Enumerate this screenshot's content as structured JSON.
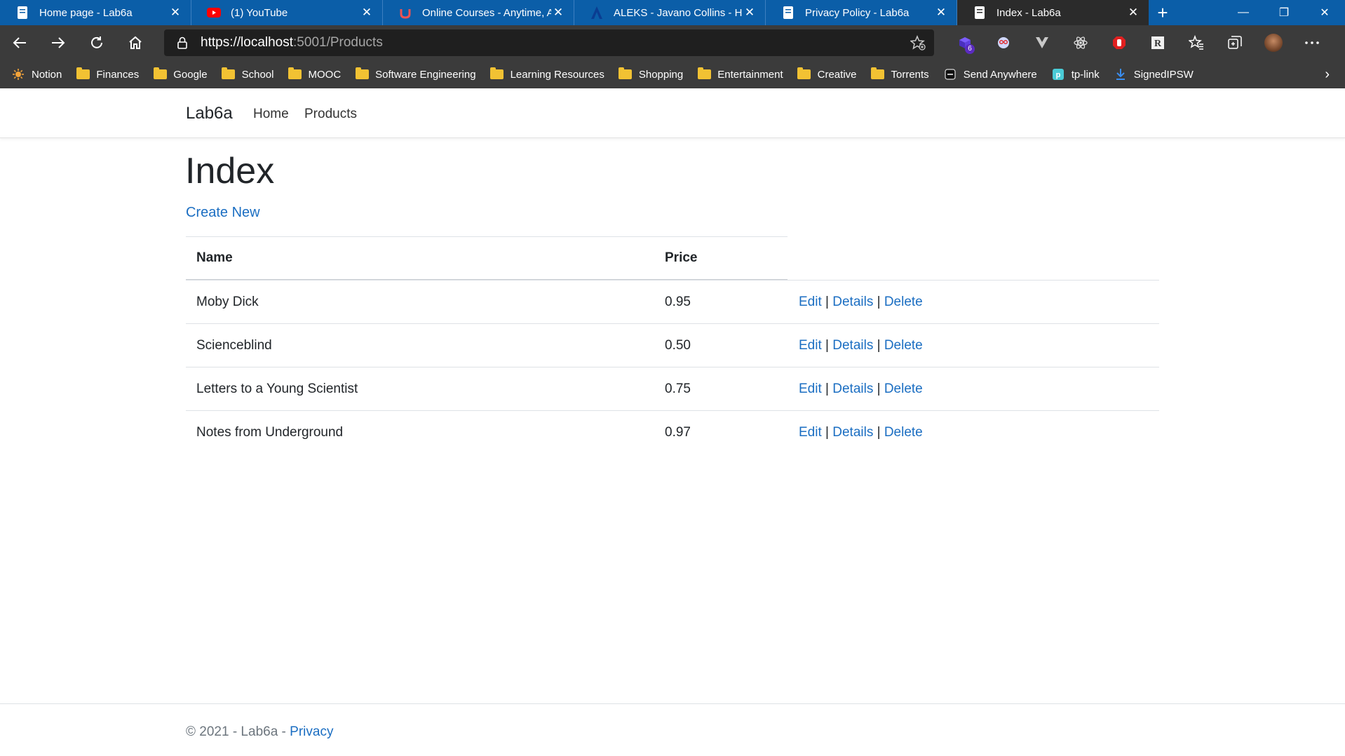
{
  "browser": {
    "tabs": [
      {
        "title": "Home page - Lab6a",
        "icon": "page-icon",
        "active": false
      },
      {
        "title": "(1) YouTube",
        "icon": "youtube-icon",
        "active": false
      },
      {
        "title": "Online Courses - Anytime, Ar",
        "icon": "udemy-icon",
        "active": false
      },
      {
        "title": "ALEKS - Javano Collins - Hon",
        "icon": "aleks-icon",
        "active": false
      },
      {
        "title": "Privacy Policy - Lab6a",
        "icon": "page-icon",
        "active": false
      },
      {
        "title": "Index - Lab6a",
        "icon": "page-icon",
        "active": true
      }
    ],
    "url_host": "https://localhost",
    "url_rest": ":5001/Products",
    "extension_badge": "6",
    "bookmarks": [
      {
        "label": "Notion",
        "icon": "notion-icon"
      },
      {
        "label": "Finances",
        "icon": "folder-icon"
      },
      {
        "label": "Google",
        "icon": "folder-icon"
      },
      {
        "label": "School",
        "icon": "folder-icon"
      },
      {
        "label": "MOOC",
        "icon": "folder-icon"
      },
      {
        "label": "Software Engineering",
        "icon": "folder-icon"
      },
      {
        "label": "Learning Resources",
        "icon": "folder-icon"
      },
      {
        "label": "Shopping",
        "icon": "folder-icon"
      },
      {
        "label": "Entertainment",
        "icon": "folder-icon"
      },
      {
        "label": "Creative",
        "icon": "folder-icon"
      },
      {
        "label": "Torrents",
        "icon": "folder-icon"
      },
      {
        "label": "Send Anywhere",
        "icon": "send-anywhere-icon"
      },
      {
        "label": "tp-link",
        "icon": "tplink-icon"
      },
      {
        "label": "SignedIPSW",
        "icon": "download-icon"
      }
    ]
  },
  "site": {
    "brand": "Lab6a",
    "nav": {
      "home": "Home",
      "products": "Products"
    },
    "page_title": "Index",
    "create_new": "Create New",
    "table": {
      "headers": {
        "name": "Name",
        "price": "Price"
      },
      "rows": [
        {
          "name": "Moby Dick",
          "price": "0.95"
        },
        {
          "name": "Scienceblind",
          "price": "0.50"
        },
        {
          "name": "Letters to a Young Scientist",
          "price": "0.75"
        },
        {
          "name": "Notes from Underground",
          "price": "0.97"
        }
      ],
      "actions": {
        "edit": "Edit",
        "details": "Details",
        "delete": "Delete",
        "separator": "|"
      }
    },
    "footer": {
      "text": "© 2021 - Lab6a - ",
      "privacy": "Privacy"
    }
  },
  "colors": {
    "link": "#1b6ec2",
    "tabstrip": "#0b5ea8",
    "toolbar": "#3b3b3b"
  }
}
